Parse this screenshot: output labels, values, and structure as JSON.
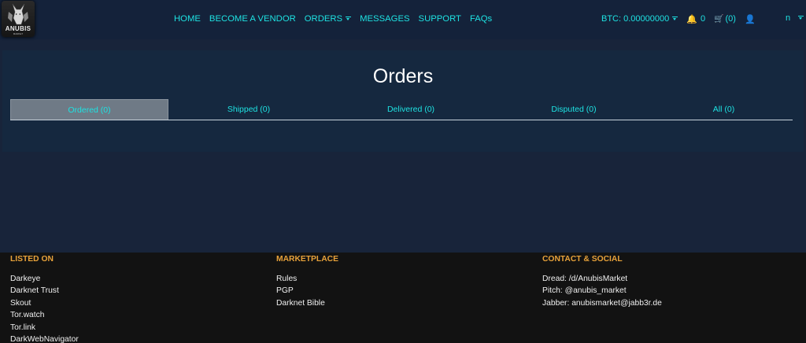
{
  "brand": {
    "name": "ANUBIS",
    "subtitle": "MARKET"
  },
  "nav": {
    "items": [
      {
        "label": "HOME"
      },
      {
        "label": "BECOME A VENDOR"
      },
      {
        "label": "ORDERS"
      },
      {
        "label": "MESSAGES"
      },
      {
        "label": "SUPPORT"
      },
      {
        "label": "FAQs"
      }
    ],
    "btc_balance": "BTC: 0.00000000",
    "notifications_count": "0",
    "cart_count": "(0)",
    "user_name": "n"
  },
  "main": {
    "title": "Orders",
    "tabs": [
      {
        "label": "Ordered (0)"
      },
      {
        "label": "Shipped (0)"
      },
      {
        "label": "Delivered (0)"
      },
      {
        "label": "Disputed (0)"
      },
      {
        "label": "All (0)"
      }
    ]
  },
  "footer": {
    "listed_on": {
      "heading": "LISTED ON",
      "items": [
        "Darkeye",
        "Darknet Trust",
        "Skout",
        "Tor.watch",
        "Tor.link",
        "DarkWebNavigator"
      ]
    },
    "marketplace": {
      "heading": "MARKETPLACE",
      "items": [
        "Rules",
        "PGP",
        "Darknet Bible"
      ]
    },
    "contact": {
      "heading": "CONTACT & SOCIAL",
      "items": [
        "Dread: /d/AnubisMarket",
        "Pitch: @anubis_market",
        "Jabber: anubismarket@jabb3r.de"
      ]
    }
  },
  "colors": {
    "accent": "#1ee2e2",
    "footer_heading": "#e8a23a",
    "background": "#18243a",
    "active_tab": "#6f7a86"
  }
}
